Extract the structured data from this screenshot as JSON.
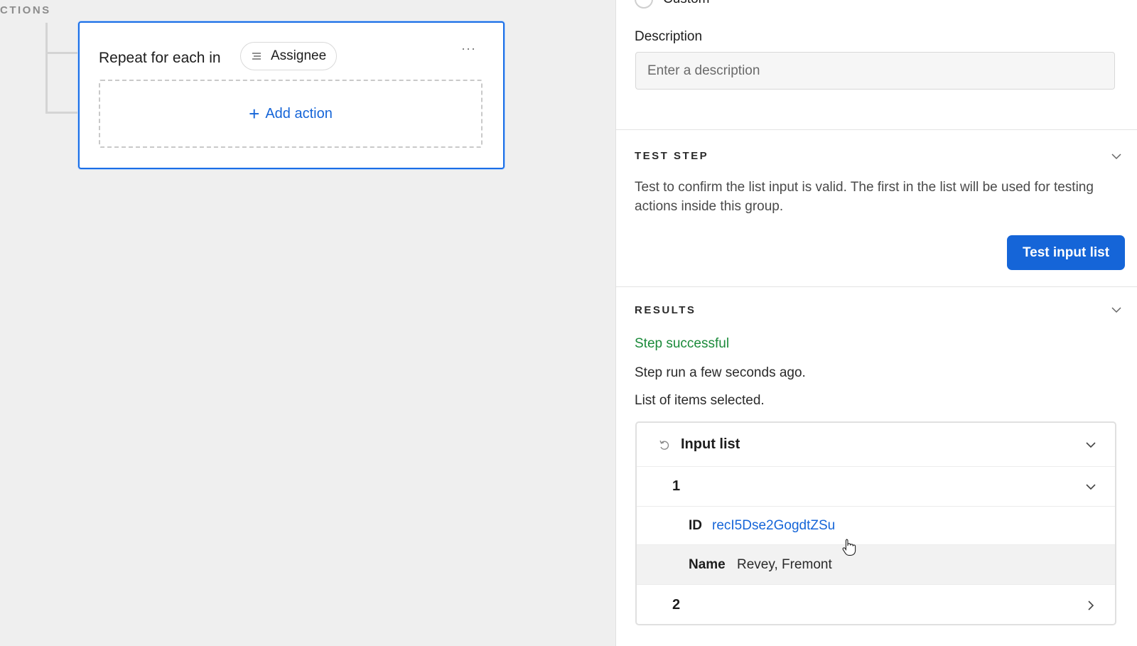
{
  "canvas": {
    "section_label": "CTIONS",
    "group": {
      "title": "Repeat for each in",
      "field_chip": "Assignee",
      "more_label": "···",
      "add_action_label": "Add action"
    }
  },
  "panel": {
    "custom_option_label": "Custom",
    "description": {
      "label": "Description",
      "placeholder": "Enter a description",
      "value": ""
    },
    "test_step": {
      "heading": "TEST STEP",
      "text": "Test to confirm the list input is valid. The first in the list will be used for testing actions inside this group.",
      "button_label": "Test input list"
    },
    "results": {
      "heading": "RESULTS",
      "status": "Step successful",
      "run_time": "Step run a few seconds ago.",
      "info": "List of items selected.",
      "input_list_label": "Input list",
      "items": [
        {
          "index": "1",
          "fields": [
            {
              "key": "ID",
              "value": "recI5Dse2GogdtZSu"
            },
            {
              "key": "Name",
              "value": "Revey, Fremont"
            }
          ]
        },
        {
          "index": "2"
        }
      ]
    }
  },
  "colors": {
    "accent": "#1565d8",
    "success": "#1b8a3a",
    "selection_border": "#1a6ee6"
  }
}
